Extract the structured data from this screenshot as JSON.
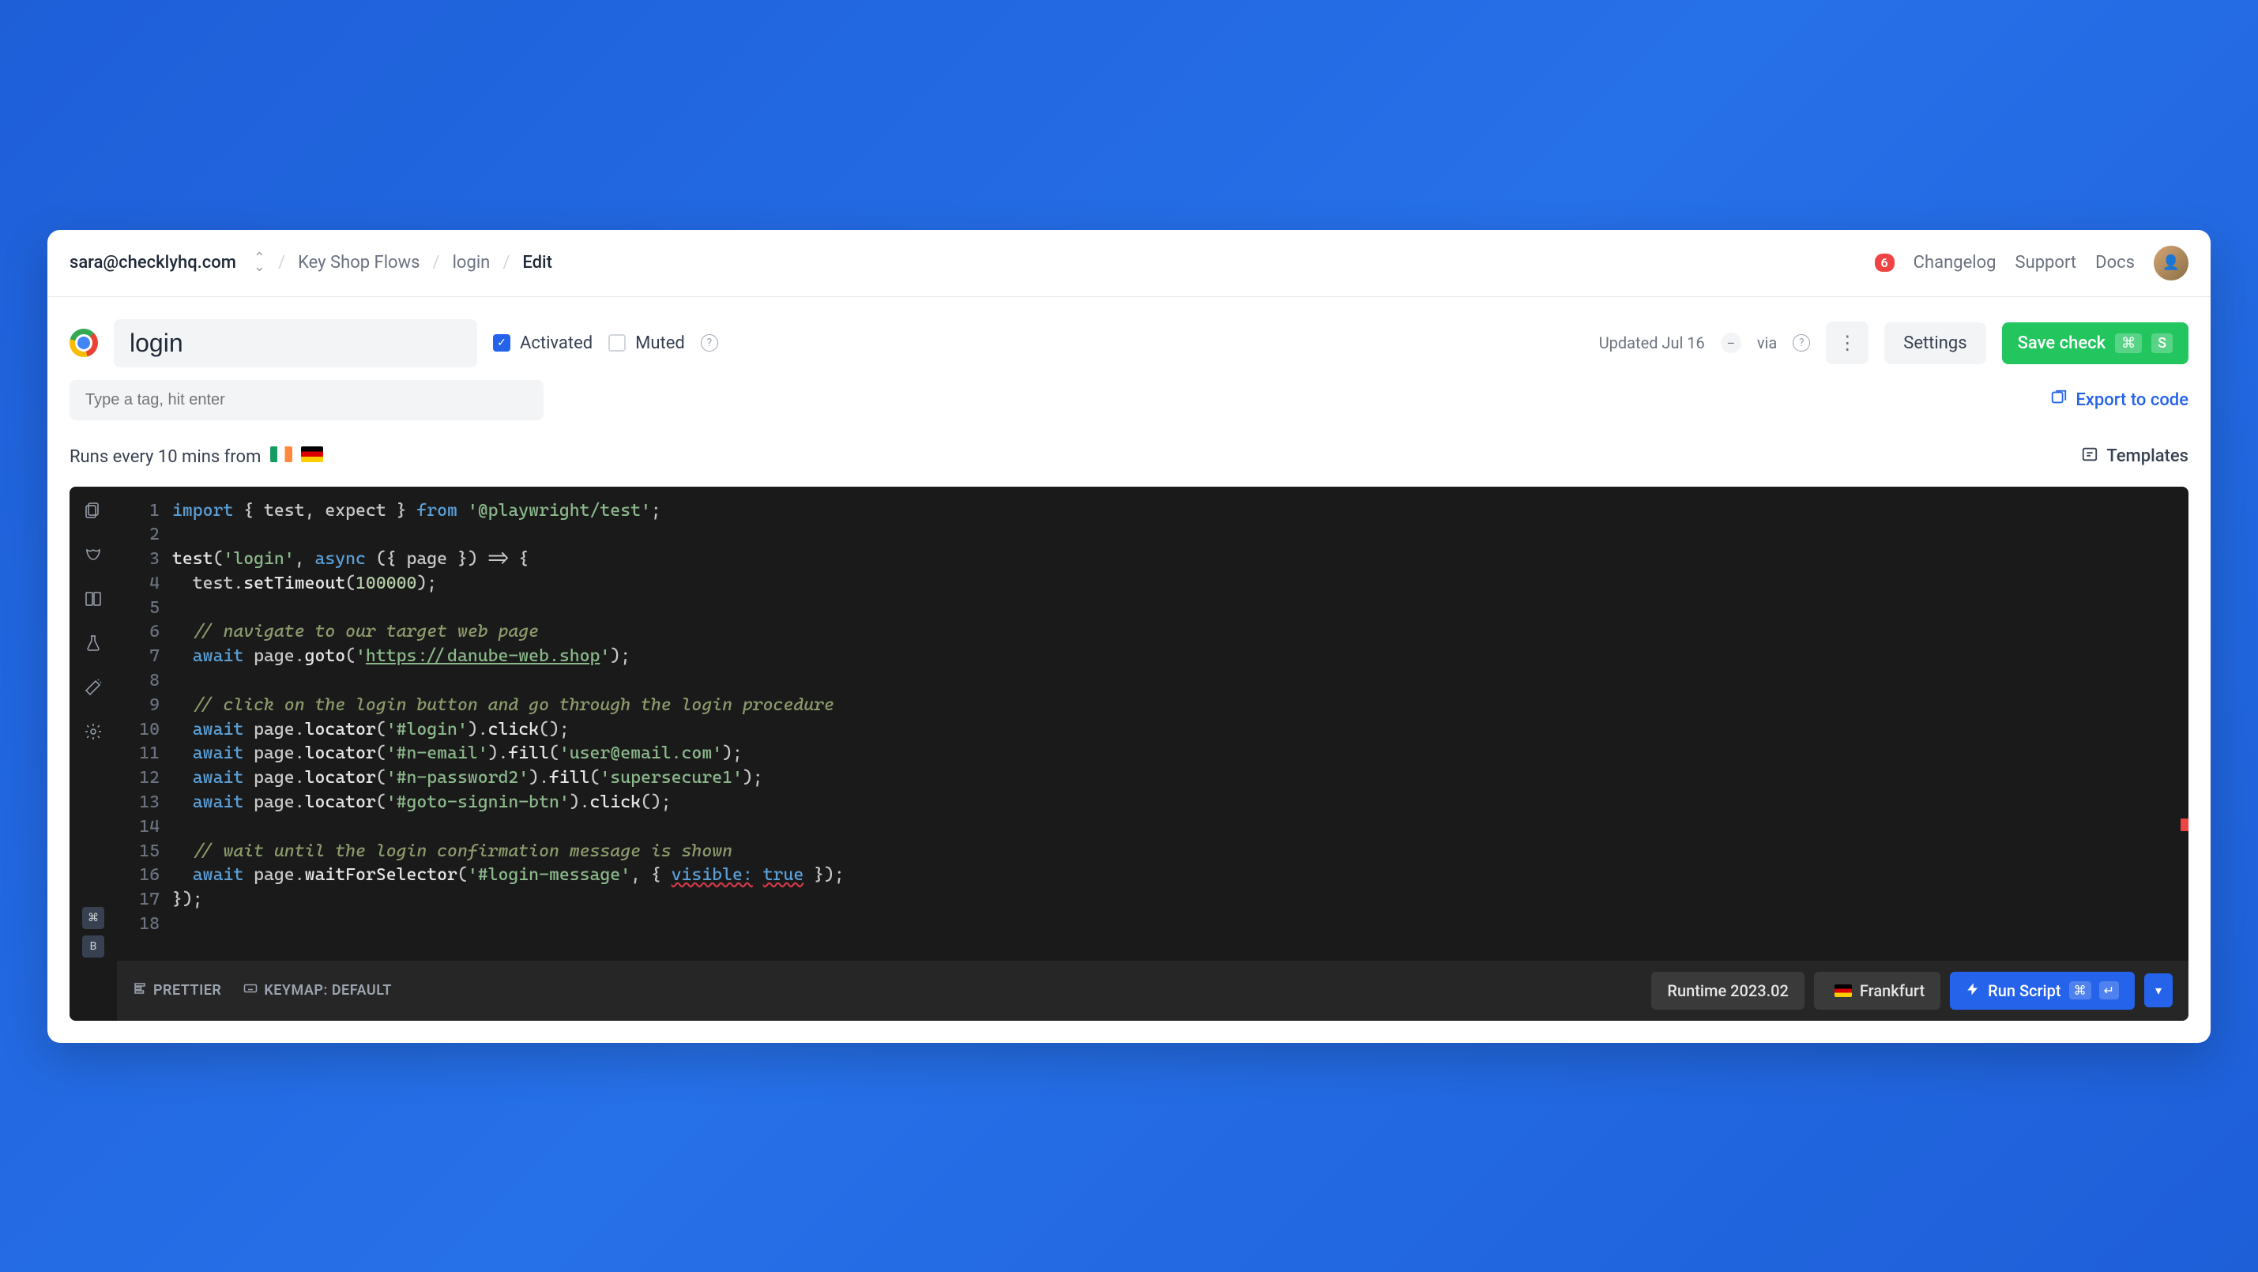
{
  "breadcrumb": {
    "email": "sara@checklyhq.com",
    "group": "Key Shop Flows",
    "check": "login",
    "action": "Edit"
  },
  "topnav": {
    "changelog_count": "6",
    "changelog": "Changelog",
    "support": "Support",
    "docs": "Docs"
  },
  "header": {
    "check_name": "login",
    "activated_label": "Activated",
    "muted_label": "Muted",
    "updated": "Updated Jul 16",
    "via": "via",
    "settings": "Settings",
    "save": "Save check",
    "save_kbd1": "⌘",
    "save_kbd2": "S"
  },
  "row2": {
    "tag_placeholder": "Type a tag, hit enter",
    "export": "Export to code"
  },
  "row3": {
    "runs": "Runs every 10 mins from",
    "templates": "Templates"
  },
  "code": {
    "lines": [
      {
        "n": "1"
      },
      {
        "n": "2"
      },
      {
        "n": "3"
      },
      {
        "n": "4"
      },
      {
        "n": "5"
      },
      {
        "n": "6"
      },
      {
        "n": "7"
      },
      {
        "n": "8"
      },
      {
        "n": "9"
      },
      {
        "n": "10"
      },
      {
        "n": "11"
      },
      {
        "n": "12"
      },
      {
        "n": "13"
      },
      {
        "n": "14"
      },
      {
        "n": "15"
      },
      {
        "n": "16"
      },
      {
        "n": "17"
      },
      {
        "n": "18"
      }
    ],
    "l1_import": "import",
    "l1_brace": " { ",
    "l1_ids": "test, expect",
    "l1_brace2": " } ",
    "l1_from": "from",
    "l1_pkg": " '@playwright/test'",
    "l1_semi": ";",
    "l3_fn": "test",
    "l3_a": "(",
    "l3_name": "'login'",
    "l3_b": ", ",
    "l3_async": "async",
    "l3_c": " ({ ",
    "l3_page": "page",
    "l3_d": " }) => {",
    "l4_a": "  test.",
    "l4_fn": "setTimeout",
    "l4_b": "(",
    "l4_num": "100000",
    "l4_c": ");",
    "l6": "  // navigate to our target web page",
    "l7_a": "  ",
    "l7_await": "await",
    "l7_b": " page.",
    "l7_fn": "goto",
    "l7_c": "(",
    "l7_q": "'",
    "l7_url": "https://danube-web.shop",
    "l7_q2": "'",
    "l7_d": ");",
    "l9": "  // click on the login button and go through the login procedure",
    "l10_a": "  ",
    "l10_await": "await",
    "l10_b": " page.",
    "l10_loc": "locator",
    "l10_c": "(",
    "l10_sel": "'#login'",
    "l10_d": ").",
    "l10_click": "click",
    "l10_e": "();",
    "l11_a": "  ",
    "l11_await": "await",
    "l11_b": " page.",
    "l11_loc": "locator",
    "l11_c": "(",
    "l11_sel": "'#n-email'",
    "l11_d": ").",
    "l11_fill": "fill",
    "l11_e": "(",
    "l11_val": "'user@email.com'",
    "l11_f": ");",
    "l12_a": "  ",
    "l12_await": "await",
    "l12_b": " page.",
    "l12_loc": "locator",
    "l12_c": "(",
    "l12_sel": "'#n-password2'",
    "l12_d": ").",
    "l12_fill": "fill",
    "l12_e": "(",
    "l12_val": "'supersecure1'",
    "l12_f": ");",
    "l13_a": "  ",
    "l13_await": "await",
    "l13_b": " page.",
    "l13_loc": "locator",
    "l13_c": "(",
    "l13_sel": "'#goto-signin-btn'",
    "l13_d": ").",
    "l13_click": "click",
    "l13_e": "();",
    "l15": "  // wait until the login confirmation message is shown",
    "l16_a": "  ",
    "l16_await": "await",
    "l16_b": " page.",
    "l16_fn": "waitForSelector",
    "l16_c": "(",
    "l16_sel": "'#login-message'",
    "l16_d": ", { ",
    "l16_vis": "visible:",
    "l16_sp": " ",
    "l16_true": "true",
    "l16_e": " });",
    "l17": "});"
  },
  "footer": {
    "prettier": "PRETTIER",
    "keymap": "KEYMAP: DEFAULT",
    "runtime": "Runtime 2023.02",
    "location": "Frankfurt",
    "run": "Run Script",
    "run_kbd1": "⌘",
    "run_kbd2": "↵"
  },
  "sidebar_kbd": {
    "cmd": "⌘",
    "b": "B"
  }
}
